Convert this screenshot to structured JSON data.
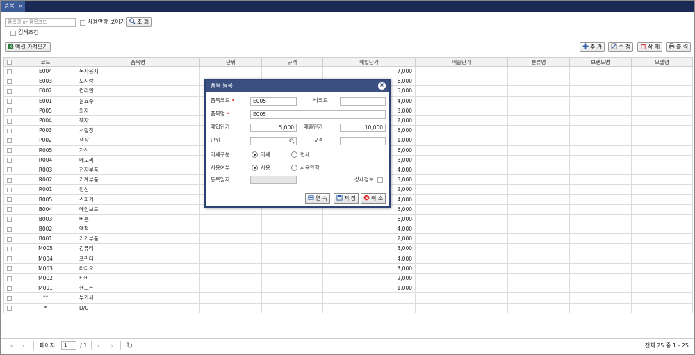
{
  "tab": {
    "label": "품목",
    "close": "×"
  },
  "search": {
    "placeholder": "품목명 or 품목코드",
    "show_unused_label": "사용안함 보이기",
    "search_button": "조 회",
    "condition_label": "검색조건"
  },
  "toolbar": {
    "excel_button": "엑셀 가져오기",
    "add_button": "추 가",
    "edit_button": "수 정",
    "delete_button": "삭 제",
    "print_button": "출 력"
  },
  "grid": {
    "columns": [
      "코드",
      "품목명",
      "단위",
      "규격",
      "매입단가",
      "매출단가",
      "분류명",
      "브랜드명",
      "모델명"
    ],
    "rows": [
      {
        "code": "E004",
        "name": "복사용지",
        "buy": "7,000"
      },
      {
        "code": "E003",
        "name": "도시락",
        "buy": "6,000"
      },
      {
        "code": "E002",
        "name": "컵라면",
        "buy": "5,000"
      },
      {
        "code": "E001",
        "name": "음료수",
        "buy": "4,000"
      },
      {
        "code": "P005",
        "name": "의자",
        "buy": "3,000"
      },
      {
        "code": "P004",
        "name": "책자",
        "buy": "2,000"
      },
      {
        "code": "P003",
        "name": "서랍장",
        "buy": "5,000"
      },
      {
        "code": "P002",
        "name": "책상",
        "buy": "1,000"
      },
      {
        "code": "R005",
        "name": "자석",
        "buy": "6,000"
      },
      {
        "code": "R004",
        "name": "메모리",
        "buy": "3,000"
      },
      {
        "code": "R003",
        "name": "전자부품",
        "buy": "4,000"
      },
      {
        "code": "R002",
        "name": "기계부품",
        "buy": "3,000"
      },
      {
        "code": "R001",
        "name": "전선",
        "buy": "2,000"
      },
      {
        "code": "B005",
        "name": "스피커",
        "buy": "4,000"
      },
      {
        "code": "B004",
        "name": "메인보드",
        "buy": "5,000"
      },
      {
        "code": "B003",
        "name": "버튼",
        "buy": "6,000"
      },
      {
        "code": "B002",
        "name": "액정",
        "buy": "4,000"
      },
      {
        "code": "B001",
        "name": "기기부품",
        "buy": "2,000"
      },
      {
        "code": "M005",
        "name": "컴퓨터",
        "buy": "3,000"
      },
      {
        "code": "M004",
        "name": "프린터",
        "buy": "4,000"
      },
      {
        "code": "M003",
        "name": "라디오",
        "buy": "3,000"
      },
      {
        "code": "M002",
        "name": "티비",
        "buy": "2,000"
      },
      {
        "code": "M001",
        "name": "핸드폰",
        "buy": "1,000"
      },
      {
        "code": "**",
        "name": "부가세",
        "buy": ""
      },
      {
        "code": "*",
        "name": "D/C",
        "buy": ""
      }
    ]
  },
  "pager": {
    "page_label": "페이지",
    "page_value": "1",
    "total_pages": "/ 1",
    "summary": "전체 25 중 1 - 25"
  },
  "modal": {
    "title": "품목 등록",
    "close": "×",
    "code_label": "품목코드",
    "code_value": "E005",
    "barcode_label": "바코드",
    "barcode_value": "",
    "name_label": "품목명",
    "name_value": "E005",
    "buy_label": "매입단가",
    "buy_value": "5,000",
    "sell_label": "매출단가",
    "sell_value": "10,000",
    "unit_label": "단위",
    "unit_value": "",
    "spec_label": "규격",
    "spec_value": "",
    "tax_label": "과세구분",
    "tax_opt1": "과세",
    "tax_opt2": "면세",
    "use_label": "사용여부",
    "use_opt1": "사용",
    "use_opt2": "사용안함",
    "regdate_label": "등록일자",
    "detail_label": "상세정보",
    "btn_continue": "연 속",
    "btn_save": "저 장",
    "btn_cancel": "취 소",
    "required_mark": "•"
  }
}
